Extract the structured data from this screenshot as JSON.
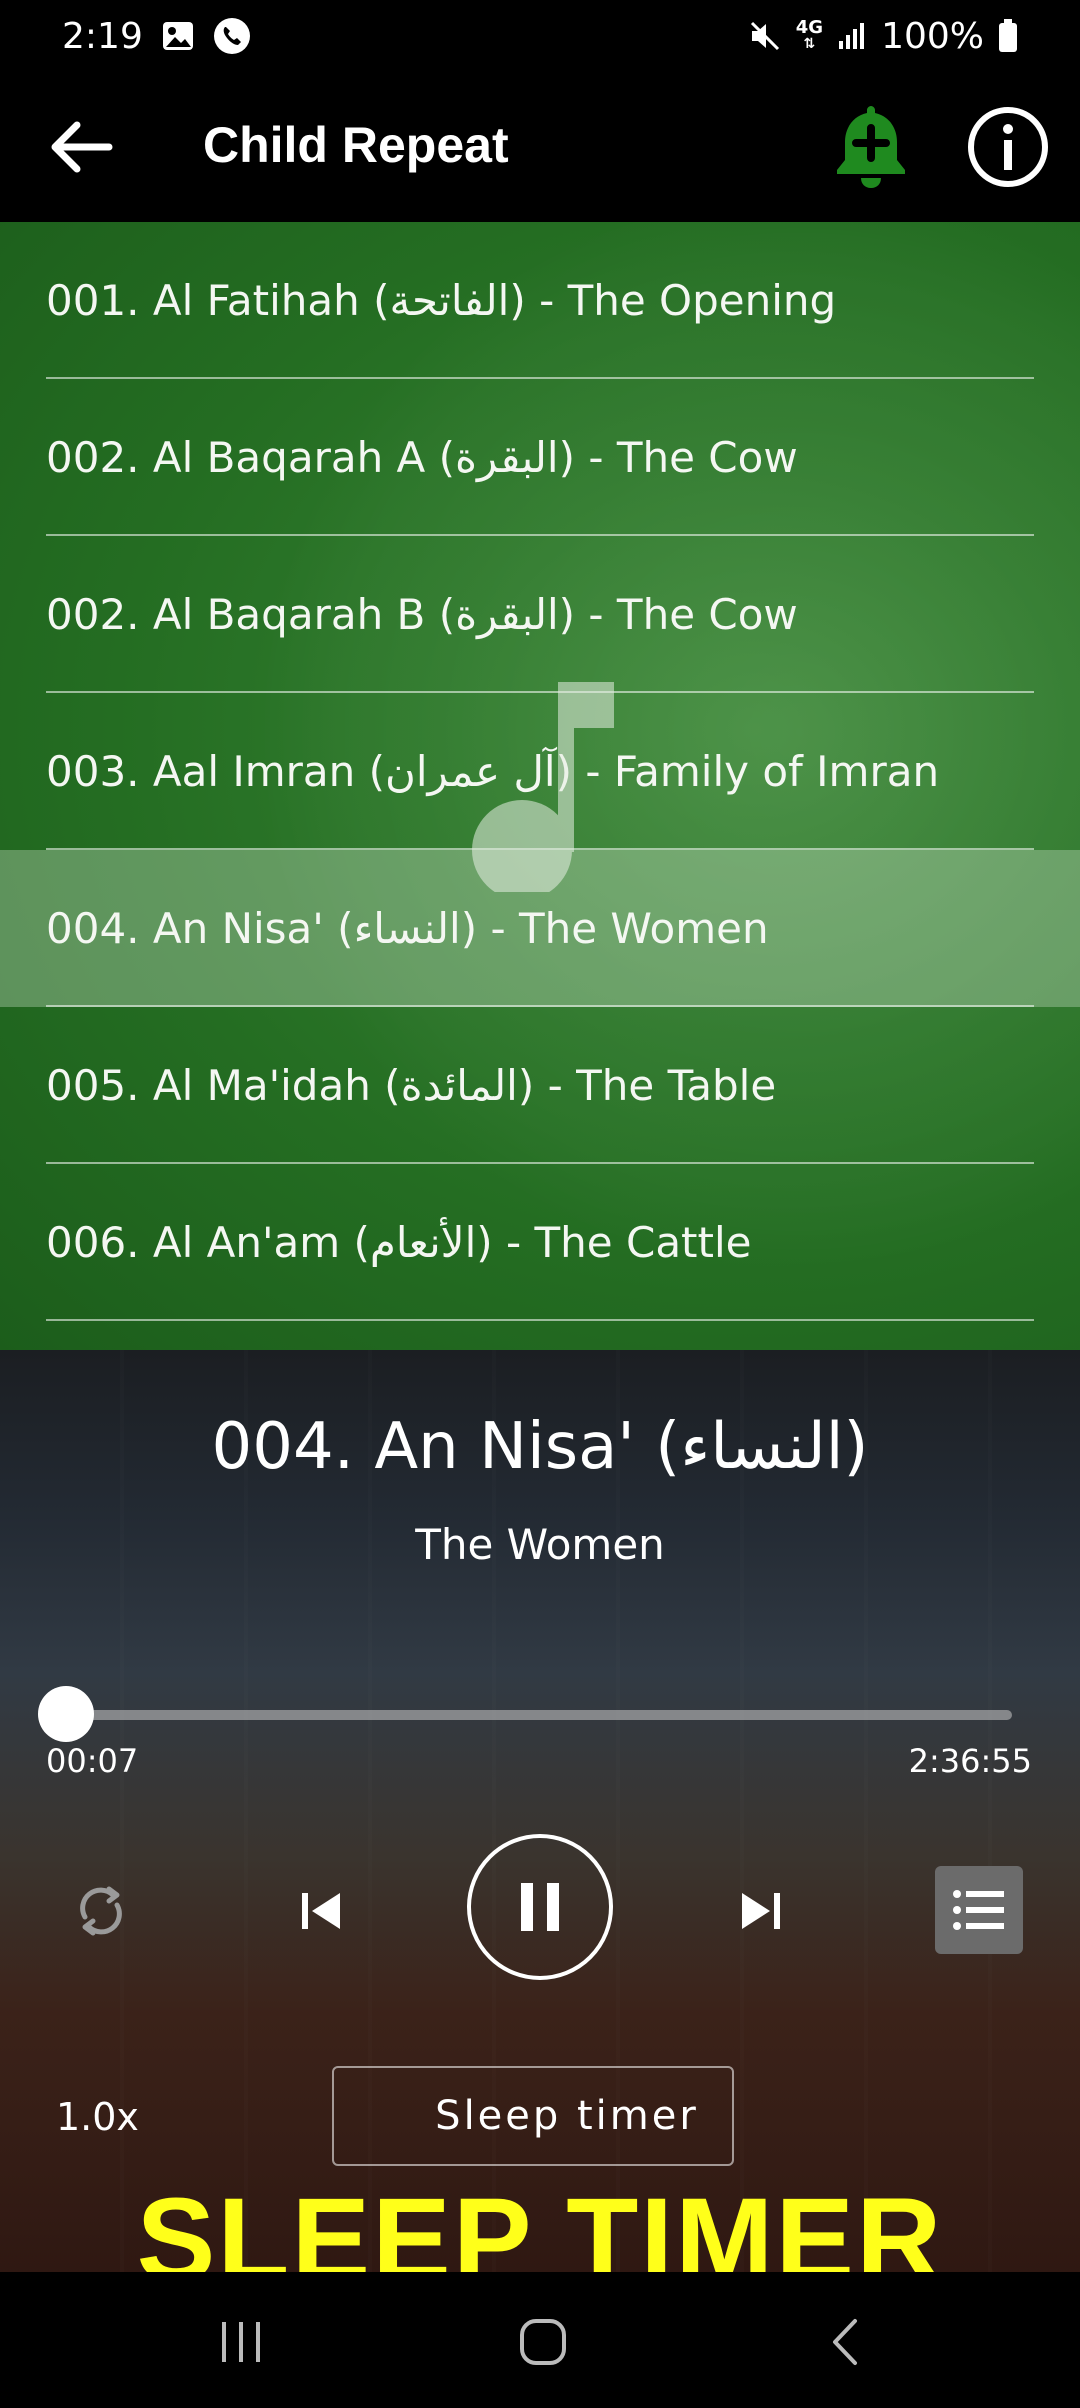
{
  "status_bar": {
    "time": "2:19",
    "network": "4G",
    "battery": "100%"
  },
  "app_bar": {
    "title": "Child Repeat"
  },
  "tracks": [
    {
      "label": "001. Al Fatihah (الفاتحة) - The Opening",
      "active": false
    },
    {
      "label": "002. Al Baqarah A (البقرة) - The Cow",
      "active": false
    },
    {
      "label": "002. Al Baqarah B (البقرة) - The Cow",
      "active": false
    },
    {
      "label": "003. Aal Imran (آل عمران) - Family of Imran",
      "active": false
    },
    {
      "label": "004. An Nisa' (النساء) - The Women",
      "active": true
    },
    {
      "label": "005. Al Ma'idah (المائدة) - The Table",
      "active": false
    },
    {
      "label": "006. Al An'am (الأنعام) - The Cattle",
      "active": false
    }
  ],
  "player": {
    "now_playing_title": "004. An Nisa' (النساء)",
    "now_playing_subtitle": "The Women",
    "current_time": "00:07",
    "total_time": "2:36:55",
    "progress_fraction": 0.0,
    "speed": "1.0x",
    "sleep_timer_label": "Sleep timer"
  },
  "banner": {
    "text": "SLEEP TIMER"
  },
  "colors": {
    "list_green": "#2f7a2c",
    "bell_green": "#1f8a1f",
    "banner_yellow": "#ffff1a"
  }
}
